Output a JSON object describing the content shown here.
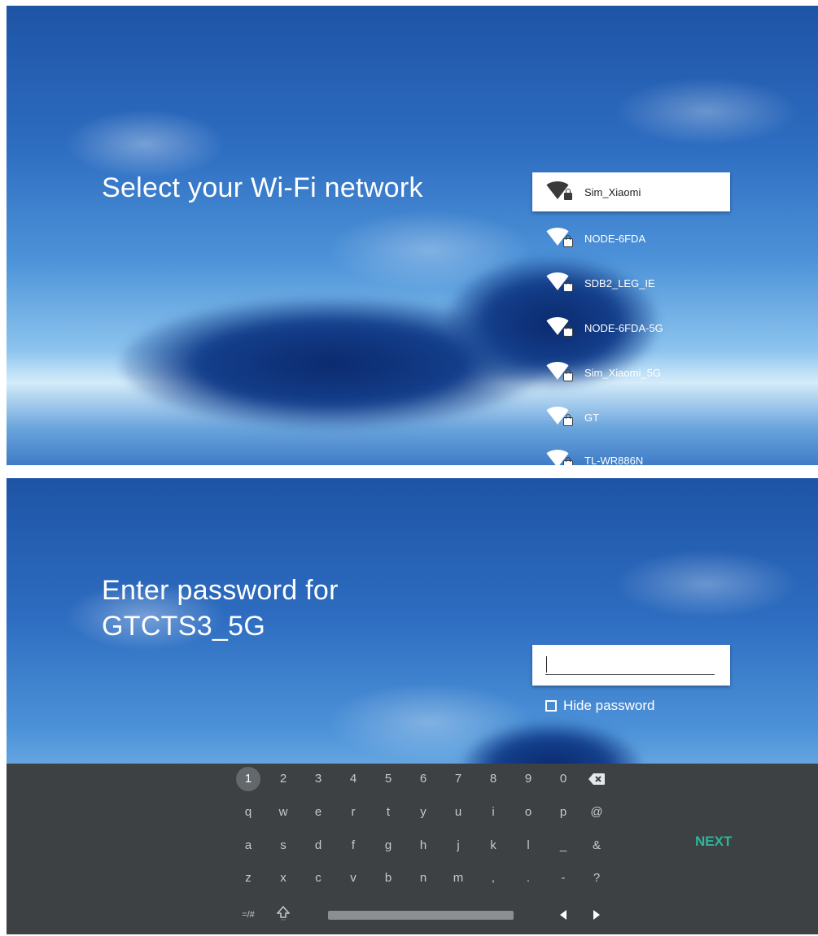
{
  "screen1": {
    "title": "Select your Wi-Fi network",
    "networks": [
      {
        "name": "Sim_Xiaomi",
        "selected": true
      },
      {
        "name": "NODE-6FDA"
      },
      {
        "name": "SDB2_LEG_IE"
      },
      {
        "name": "NODE-6FDA-5G"
      },
      {
        "name": "Sim_Xiaomi_5G"
      },
      {
        "name": "GT"
      },
      {
        "name": "TL-WR886N"
      }
    ]
  },
  "screen2": {
    "title_line1": "Enter password for",
    "title_line2": "GTCTS3_5G",
    "password_value": "",
    "hide_password_label": "Hide password",
    "keyboard": {
      "row1": [
        "1",
        "2",
        "3",
        "4",
        "5",
        "6",
        "7",
        "8",
        "9",
        "0"
      ],
      "row2": [
        "q",
        "w",
        "e",
        "r",
        "t",
        "y",
        "u",
        "i",
        "o",
        "p",
        "@"
      ],
      "row3": [
        "a",
        "s",
        "d",
        "f",
        "g",
        "h",
        "j",
        "k",
        "l",
        "_",
        "&"
      ],
      "row4": [
        "z",
        "x",
        "c",
        "v",
        "b",
        "n",
        "m",
        ",",
        ".",
        "-",
        "?"
      ],
      "symbols_key": "=/#",
      "next_label": "NEXT"
    }
  },
  "colors": {
    "accent_next": "#2bb79a",
    "keyboard_bg": "#3d4144"
  }
}
